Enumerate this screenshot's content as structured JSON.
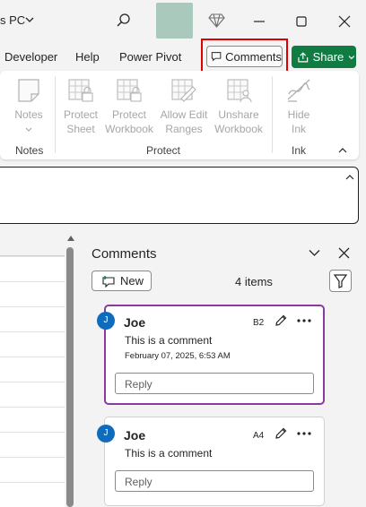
{
  "titlebar": {
    "title": "s PC"
  },
  "tabs": {
    "developer": "Developer",
    "help": "Help",
    "power_pivot": "Power Pivot"
  },
  "buttons": {
    "comments": "Comments",
    "share": "Share"
  },
  "ribbon": {
    "notes": {
      "label": "Notes",
      "group": "Notes"
    },
    "protect": {
      "group": "Protect",
      "items": [
        "Protect\nSheet",
        "Protect\nWorkbook",
        "Allow Edit\nRanges",
        "Unshare\nWorkbook"
      ]
    },
    "ink": {
      "label": "Hide\nInk",
      "group": "Ink"
    }
  },
  "comments_pane": {
    "title": "Comments",
    "new_label": "New",
    "count": "4 items",
    "comments": [
      {
        "initial": "J",
        "author": "Joe",
        "cell": "B2",
        "text": "This is a comment",
        "timestamp": "February 07, 2025, 6:53 AM",
        "reply_placeholder": "Reply",
        "active": true
      },
      {
        "initial": "J",
        "author": "Joe",
        "cell": "A4",
        "text": "This is a comment",
        "reply_placeholder": "Reply",
        "active": false
      }
    ]
  },
  "colors": {
    "accent_green": "#107c41",
    "highlight_red": "#e00000",
    "active_border": "#8a3a9e",
    "avatar_blue": "#0f6cbd"
  }
}
